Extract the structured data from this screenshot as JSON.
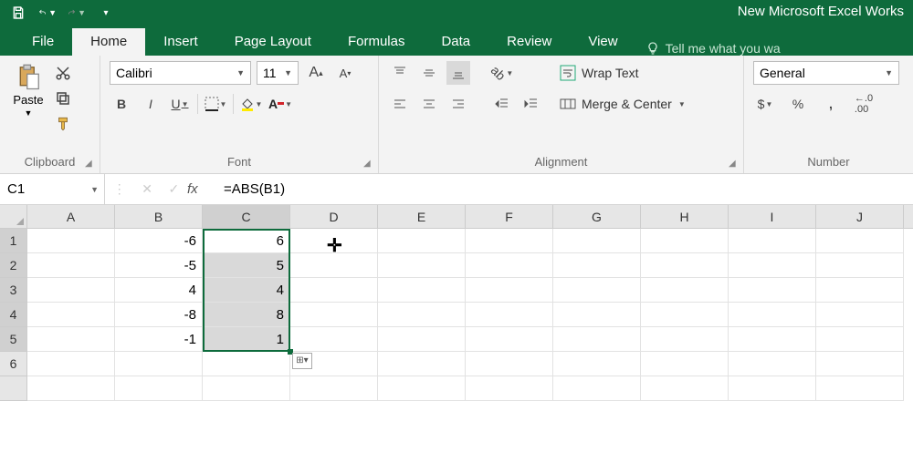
{
  "titlebar": {
    "appTitle": "New Microsoft Excel Works"
  },
  "tabs": {
    "file": "File",
    "home": "Home",
    "insert": "Insert",
    "pageLayout": "Page Layout",
    "formulas": "Formulas",
    "data": "Data",
    "review": "Review",
    "view": "View",
    "tellme": "Tell me what you wa"
  },
  "ribbon": {
    "clipboard": {
      "paste": "Paste",
      "label": "Clipboard"
    },
    "font": {
      "name": "Calibri",
      "size": "11",
      "label": "Font",
      "bold": "B",
      "italic": "I",
      "underline": "U"
    },
    "alignment": {
      "wrapText": "Wrap Text",
      "mergeCenter": "Merge & Center",
      "label": "Alignment"
    },
    "number": {
      "format": "General",
      "label": "Number",
      "currency": "$",
      "percent": "%",
      "comma": ",",
      "decInc": ".00"
    }
  },
  "formulaBar": {
    "nameBox": "C1",
    "fx": "fx",
    "formula": "=ABS(B1)"
  },
  "grid": {
    "cols": [
      "A",
      "B",
      "C",
      "D",
      "E",
      "F",
      "G",
      "H",
      "I",
      "J"
    ],
    "selectedCol": "C",
    "rows": [
      {
        "n": "1",
        "B": "-6",
        "C": "6"
      },
      {
        "n": "2",
        "B": "-5",
        "C": "5"
      },
      {
        "n": "3",
        "B": "4",
        "C": "4"
      },
      {
        "n": "4",
        "B": "-8",
        "C": "8"
      },
      {
        "n": "5",
        "B": "-1",
        "C": "1"
      },
      {
        "n": "6",
        "B": "",
        "C": ""
      }
    ],
    "selectedRows": [
      "1",
      "2",
      "3",
      "4",
      "5"
    ]
  }
}
